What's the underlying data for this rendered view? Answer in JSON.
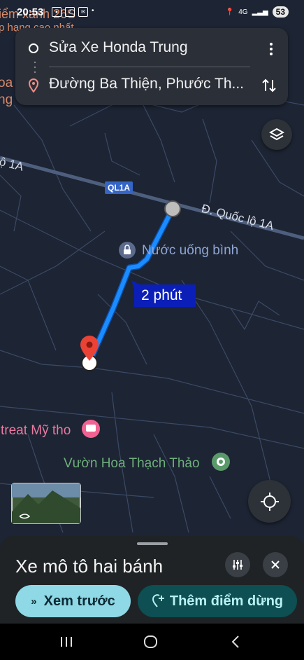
{
  "status_bar": {
    "time": "20:53",
    "network": "4G",
    "battery": "53"
  },
  "map": {
    "labels": {
      "partial_top": "iểm xanh 26S",
      "partial_top2": "p hạng cao nhất",
      "partial_left1": "oa",
      "partial_left2": "ng",
      "road_left": "lộ 1A",
      "road_shield": "QL1A",
      "road_right": "Đ. Quốc lộ 1A",
      "poi_water": "Nước uống bình",
      "poi_retreat": "treat Mỹ tho",
      "poi_garden": "Vườn Hoa Thạch Thảo"
    },
    "route_eta": "2 phút",
    "colors": {
      "route": "#1a8cff",
      "eta_bg": "#0b1fb8",
      "destination": "#ea4335",
      "poi_pink": "#f06292",
      "poi_green": "#5a9a6a"
    }
  },
  "directions_card": {
    "origin": "Sửa Xe Honda Trung",
    "destination": "Đường Ba Thiện, Phước Th..."
  },
  "bottom_sheet": {
    "mode_title": "Xe mô tô hai bánh",
    "preview_button": "Xem trước",
    "add_stop_button": "Thêm điểm dừng"
  }
}
